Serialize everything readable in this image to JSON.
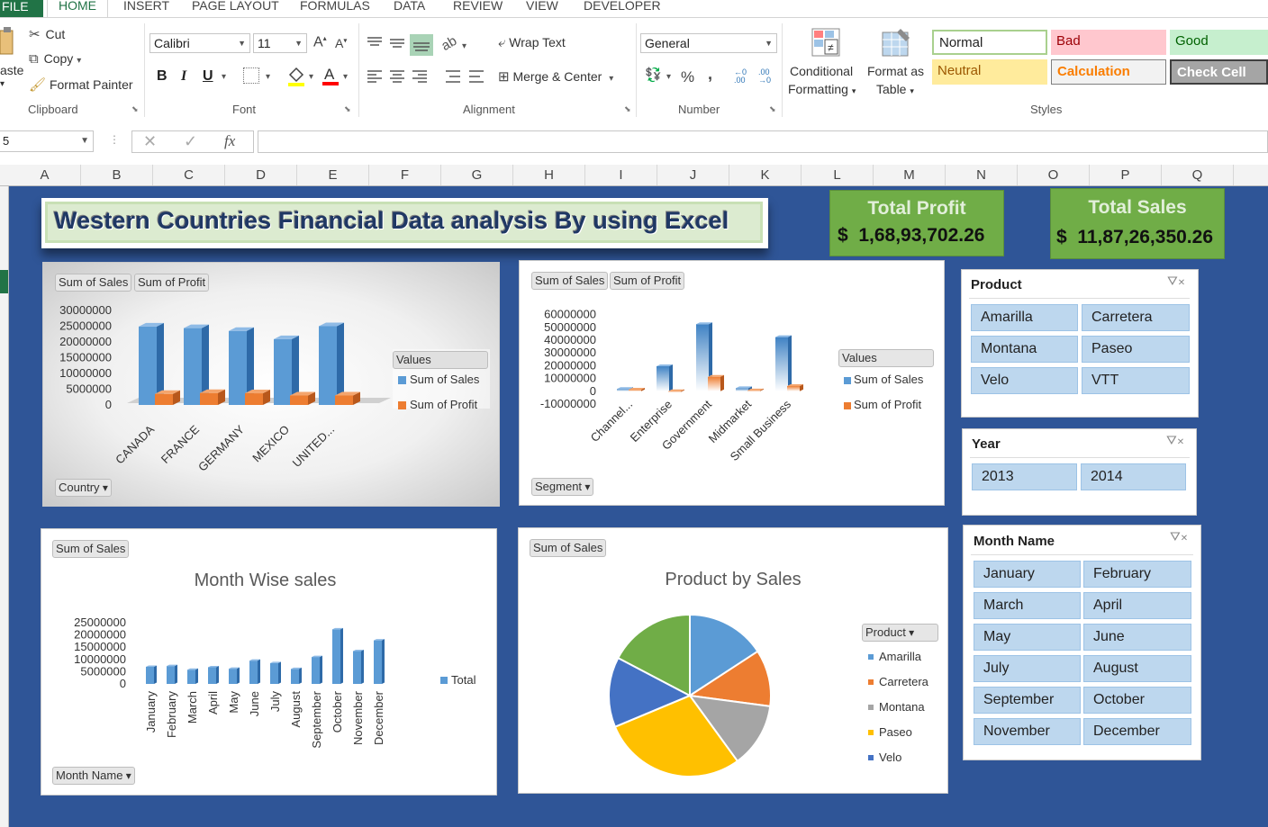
{
  "ribbon": {
    "tabs": [
      "FILE",
      "HOME",
      "INSERT",
      "PAGE LAYOUT",
      "FORMULAS",
      "DATA",
      "REVIEW",
      "VIEW",
      "DEVELOPER"
    ],
    "clipboard": {
      "paste": "aste",
      "cut": "Cut",
      "copy": "Copy",
      "format_painter": "Format Painter",
      "label": "Clipboard"
    },
    "font": {
      "name": "Calibri",
      "size": "11",
      "label": "Font",
      "grow": "A",
      "shrink": "A",
      "bold": "B",
      "italic": "I",
      "underline": "U"
    },
    "alignment": {
      "wrap": "Wrap Text",
      "merge": "Merge & Center",
      "label": "Alignment"
    },
    "number": {
      "format": "General",
      "label": "Number",
      "percent": "%",
      "comma": ","
    },
    "styles": {
      "conditional_1": "Conditional",
      "conditional_2": "Formatting",
      "format_table_1": "Format as",
      "format_table_2": "Table",
      "label": "Styles",
      "cells": [
        {
          "label": "Normal",
          "bg": "#ffffff",
          "fg": "#222222",
          "border": "#a9d08e"
        },
        {
          "label": "Bad",
          "bg": "#ffc7ce",
          "fg": "#9c0006",
          "border": "#ffc7ce"
        },
        {
          "label": "Good",
          "bg": "#c6efce",
          "fg": "#006100",
          "border": "#c6efce"
        },
        {
          "label": "Neutral",
          "bg": "#ffeb9c",
          "fg": "#9c5700",
          "border": "#ffeb9c"
        },
        {
          "label": "Calculation",
          "bg": "#f2f2f2",
          "fg": "#fa7d00",
          "border": "#7f7f7f"
        },
        {
          "label": "Check Cell",
          "bg": "#a5a5a5",
          "fg": "#ffffff",
          "border": "#3f3f3f"
        }
      ]
    }
  },
  "formula_bar": {
    "namebox": "5",
    "fx": "fx",
    "cancel": "✕",
    "enter": "✓"
  },
  "columns": [
    "A",
    "B",
    "C",
    "D",
    "E",
    "F",
    "G",
    "H",
    "I",
    "J",
    "K",
    "L",
    "M",
    "N",
    "O",
    "P",
    "Q"
  ],
  "dashboard": {
    "title": "Western Countries Financial Data analysis By using Excel",
    "kpis": [
      {
        "label": "Total Profit",
        "value": "$  1,68,93,702.26"
      },
      {
        "label": "Total Sales",
        "value": "$  11,87,26,350.26"
      }
    ]
  },
  "chart1": {
    "chips": [
      "Sum of  Sales",
      "Sum of Profit"
    ],
    "legend_title": "Values",
    "series_names": [
      "Sum of  Sales",
      "Sum of Profit"
    ],
    "filter": "Country",
    "chart_data": {
      "type": "bar",
      "categories": [
        "CANADA",
        "FRANCE",
        "GERMANY",
        "MEXICO",
        "UNITED..."
      ],
      "series": [
        {
          "name": "Sum of  Sales",
          "values": [
            24900000,
            24400000,
            23500000,
            20900000,
            25000000
          ]
        },
        {
          "name": "Sum of Profit",
          "values": [
            3500000,
            3800000,
            3700000,
            3000000,
            3000000
          ]
        }
      ],
      "yticks": [
        "30000000",
        "25000000",
        "20000000",
        "15000000",
        "10000000",
        "5000000",
        "0"
      ],
      "ylim": [
        0,
        30000000
      ]
    }
  },
  "chart2": {
    "chips": [
      "Sum of  Sales",
      "Sum of Profit"
    ],
    "legend_title": "Values",
    "series_names": [
      "Sum of  Sales",
      "Sum of Profit"
    ],
    "filter": "Segment",
    "chart_data": {
      "type": "bar",
      "categories": [
        "Channel...",
        "Enterprise",
        "Government",
        "Midmarket",
        "Small Business"
      ],
      "series": [
        {
          "name": "Sum of  Sales",
          "values": [
            1800000,
            19600000,
            52500000,
            2400000,
            42400000
          ]
        },
        {
          "name": "Sum of Profit",
          "values": [
            1300000,
            -600000,
            11300000,
            660000,
            4100000
          ]
        }
      ],
      "yticks": [
        "60000000",
        "50000000",
        "40000000",
        "30000000",
        "20000000",
        "10000000",
        "0",
        "-10000000"
      ],
      "ylim": [
        -10000000,
        60000000
      ]
    }
  },
  "chart3": {
    "chips": [
      "Sum of  Sales"
    ],
    "title": "Month Wise sales",
    "legend": "Total",
    "filter": "Month Name",
    "chart_data": {
      "type": "bar",
      "categories": [
        "January",
        "February",
        "March",
        "April",
        "May",
        "June",
        "July",
        "August",
        "September",
        "October",
        "November",
        "December"
      ],
      "series": [
        {
          "name": "Total",
          "values": [
            7000000,
            7300000,
            5800000,
            6800000,
            6200000,
            9500000,
            8500000,
            6100000,
            11000000,
            22300000,
            13400000,
            17800000
          ]
        }
      ],
      "yticks": [
        "25000000",
        "20000000",
        "15000000",
        "10000000",
        "5000000",
        "0"
      ],
      "ylim": [
        0,
        25000000
      ]
    }
  },
  "chart4": {
    "chips": [
      "Sum of  Sales"
    ],
    "title": "Product by Sales",
    "filter": "Product",
    "chart_data": {
      "type": "pie",
      "categories": [
        "Amarilla",
        "Carretera",
        "Montana",
        "Paseo",
        "Velo",
        "VTT"
      ],
      "values": [
        15.8,
        11.3,
        12.9,
        28.7,
        14.0,
        17.3
      ],
      "colors": [
        "#5b9bd5",
        "#ed7d31",
        "#a5a5a5",
        "#ffc000",
        "#4472c4",
        "#70ad47"
      ],
      "legend_shown": [
        "Amarilla",
        "Carretera",
        "Montana",
        "Paseo",
        "Velo"
      ]
    }
  },
  "slicers": {
    "product": {
      "title": "Product",
      "items": [
        "Amarilla",
        "Carretera",
        "Montana",
        "Paseo",
        "Velo",
        "VTT"
      ]
    },
    "year": {
      "title": "Year",
      "items": [
        "2013",
        "2014"
      ]
    },
    "month": {
      "title": "Month Name",
      "items": [
        "January",
        "February",
        "March",
        "April",
        "May",
        "June",
        "July",
        "August",
        "September",
        "October",
        "November",
        "December"
      ]
    }
  }
}
